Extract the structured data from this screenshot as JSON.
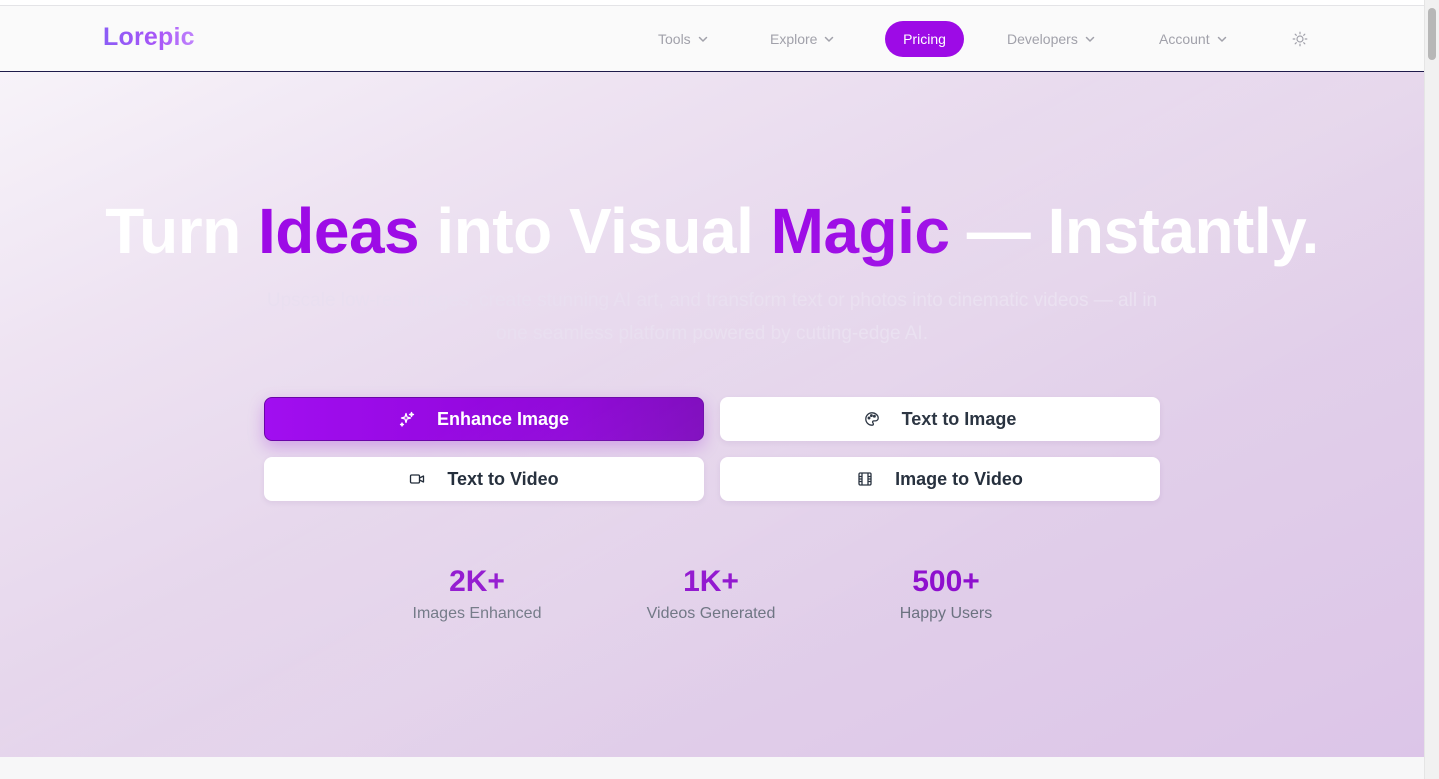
{
  "brand": {
    "logo_text": "Lorepic"
  },
  "nav": {
    "tools": "Tools",
    "explore": "Explore",
    "pricing": "Pricing",
    "developers": "Developers",
    "account": "Account"
  },
  "hero": {
    "headline": {
      "part1": "Turn ",
      "highlight1": "Ideas",
      "part2": " into Visual ",
      "highlight2": "Magic",
      "part3": " — Instantly."
    },
    "subtitle": "Upscale low-res images, create stunning AI art, and transform text or photos into cinematic videos — all in one seamless platform powered by cutting-edge AI.",
    "buttons": {
      "enhance_image": "Enhance Image",
      "text_to_image": "Text to Image",
      "text_to_video": "Text to Video",
      "image_to_video": "Image to Video"
    },
    "stats": [
      {
        "value": "2K+",
        "label": "Images Enhanced"
      },
      {
        "value": "1K+",
        "label": "Videos Generated"
      },
      {
        "value": "500+",
        "label": "Happy Users"
      }
    ]
  },
  "icons": {
    "chevron": "chevron-down-icon",
    "theme": "sun-icon",
    "enhance": "sparkles-icon",
    "text_to_image": "palette-icon",
    "text_to_video": "video-camera-icon",
    "image_to_video": "film-icon"
  },
  "colors": {
    "accent": "#9d0be6",
    "stat_value": "#8e0fce",
    "hero_background": "#e3d2ea"
  }
}
